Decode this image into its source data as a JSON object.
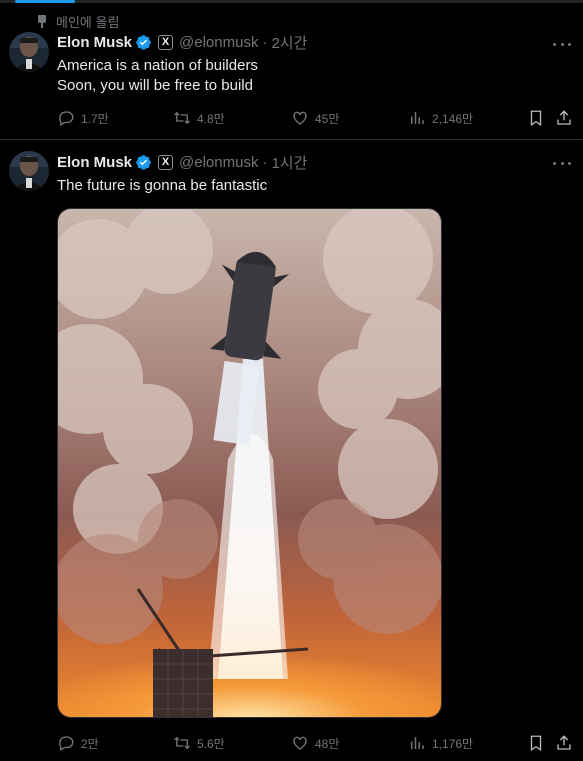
{
  "pinned_label": "메인에 올림",
  "tweets": [
    {
      "name": "Elon Musk",
      "x_badge": "X",
      "handle": "@elonmusk",
      "time": "2시간",
      "text_lines": [
        "America is a nation of builders",
        "Soon, you will be free to build"
      ],
      "replies": "1.7만",
      "retweets": "4.8만",
      "likes": "45만",
      "views": "2,146만"
    },
    {
      "name": "Elon Musk",
      "x_badge": "X",
      "handle": "@elonmusk",
      "time": "1시간",
      "text_lines": [
        "The future is gonna be fantastic"
      ],
      "replies": "2만",
      "retweets": "5.6만",
      "likes": "48만",
      "views": "1,176만"
    }
  ],
  "dot_separator": "·",
  "colors": {
    "background": "#000000",
    "text": "#e7e9ea",
    "muted": "#71767b",
    "verified": "#1d9bf0",
    "border": "#2f3336"
  }
}
